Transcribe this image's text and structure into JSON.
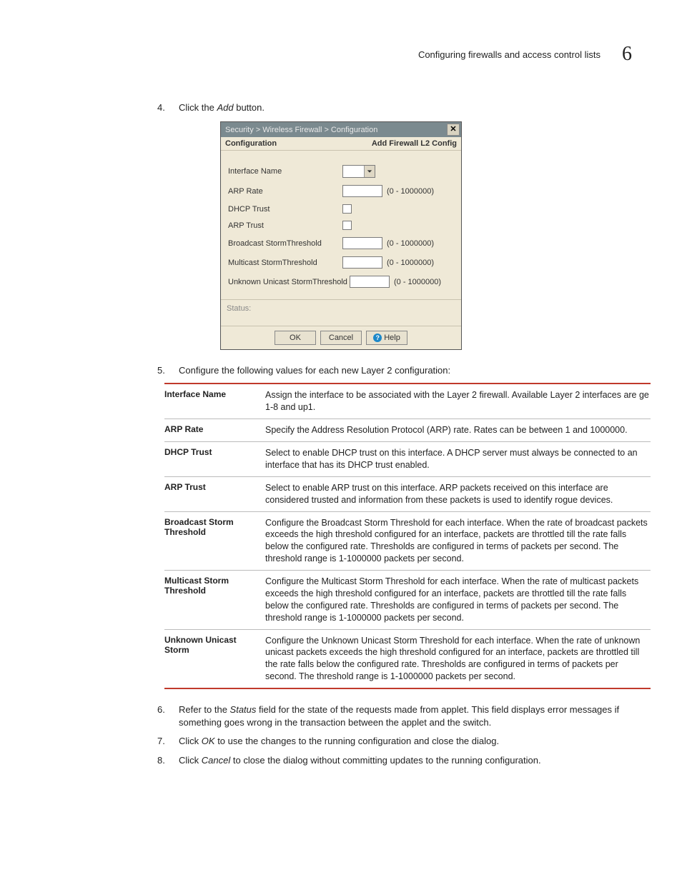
{
  "header": {
    "title": "Configuring firewalls and access control lists",
    "chapter": "6"
  },
  "steps": {
    "s4": {
      "num": "4.",
      "text_a": "Click the ",
      "em": "Add",
      "text_b": " button."
    },
    "s5": {
      "num": "5.",
      "text": "Configure the following values for each new Layer 2 configuration:"
    },
    "s6": {
      "num": "6.",
      "text_a": "Refer to the ",
      "em": "Status",
      "text_b": " field for the state of the requests made from applet. This field displays error messages if something goes wrong in the transaction between the applet and the switch."
    },
    "s7": {
      "num": "7.",
      "text_a": "Click ",
      "em": "OK",
      "text_b": " to use the changes to the running configuration and close the dialog."
    },
    "s8": {
      "num": "8.",
      "text_a": "Click ",
      "em": "Cancel",
      "text_b": " to close the dialog without committing updates to the running configuration."
    }
  },
  "dialog": {
    "titlebar": "Security > Wireless Firewall > Configuration",
    "close_glyph": "✕",
    "sub_left": "Configuration",
    "sub_right": "Add Firewall L2 Config",
    "labels": {
      "iface": "Interface Name",
      "arp_rate": "ARP Rate",
      "dhcp_trust": "DHCP Trust",
      "arp_trust": "ARP Trust",
      "bcast": "Broadcast StormThreshold",
      "mcast": "Multicast StormThreshold",
      "unk": "Unknown Unicast StormThreshold"
    },
    "range": "(0 - 1000000)",
    "status_label": "Status:",
    "btn_ok": "OK",
    "btn_cancel": "Cancel",
    "btn_help": "Help",
    "help_glyph": "?"
  },
  "defs": [
    {
      "term": "Interface Name",
      "desc": "Assign the interface to be associated with the Layer 2 firewall. Available Layer 2 interfaces are ge 1-8 and up1."
    },
    {
      "term": "ARP Rate",
      "desc": "Specify the Address Resolution Protocol (ARP) rate. Rates can be between 1 and 1000000."
    },
    {
      "term": "DHCP Trust",
      "desc": "Select to enable DHCP trust on this interface. A DHCP server must always be connected to an interface that has its DHCP trust enabled."
    },
    {
      "term": "ARP Trust",
      "desc": "Select to enable ARP trust on this interface. ARP packets received on this interface are considered trusted and information from these packets is used to identify rogue devices."
    },
    {
      "term": "Broadcast Storm Threshold",
      "desc": "Configure the Broadcast Storm Threshold for each interface. When the rate of broadcast packets exceeds the high threshold configured for an interface, packets are throttled till the rate falls below the configured rate. Thresholds are configured in terms of packets per second. The threshold range is 1-1000000 packets per second."
    },
    {
      "term": "Multicast Storm Threshold",
      "desc": "Configure the Multicast Storm Threshold for each interface. When the rate of multicast packets exceeds the high threshold configured for an interface, packets are throttled till the rate falls below the configured rate. Thresholds are configured in terms of packets per second. The threshold range is 1-1000000 packets per second."
    },
    {
      "term": "Unknown Unicast Storm",
      "desc": "Configure the Unknown Unicast Storm Threshold for each interface. When the rate of unknown unicast packets exceeds the high threshold configured for an interface, packets are throttled till the rate falls below the configured rate. Thresholds are configured in terms of packets per second. The threshold range is 1-1000000 packets per second."
    }
  ]
}
